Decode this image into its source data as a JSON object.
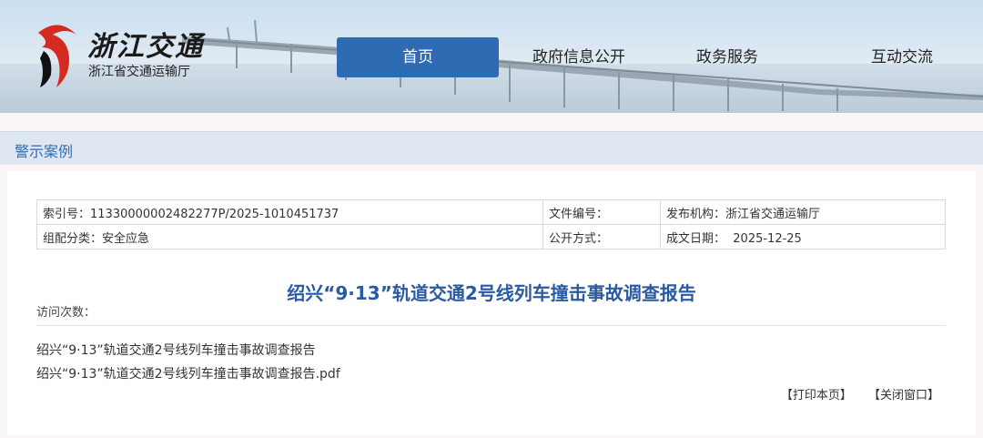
{
  "header": {
    "logo_title": "浙江交通",
    "logo_subtitle": "浙江省交通运输厅"
  },
  "nav": {
    "items": [
      {
        "label": "首页",
        "active": true
      },
      {
        "label": "政府信息公开"
      },
      {
        "label": "政务服务"
      },
      {
        "label": "互动交流"
      }
    ]
  },
  "section": {
    "title": "警示案例"
  },
  "meta": {
    "index_label": "索引号：",
    "index_value": "11330000002482277P/2025-1010451737",
    "doc_no_label": "文件编号：",
    "doc_no_value": "",
    "publisher_label": "发布机构：",
    "publisher_value": "浙江省交通运输厅",
    "category_label": "组配分类：",
    "category_value": "安全应急",
    "disclosure_label": "公开方式：",
    "disclosure_value": "",
    "date_label": "成文日期：",
    "date_value": "2025-12-25"
  },
  "article": {
    "title": "绍兴“9·13”轨道交通2号线列车撞击事故调查报告",
    "visits_label": "访问次数：",
    "line1": "绍兴“9·13”轨道交通2号线列车撞击事故调查报告",
    "line2": "绍兴“9·13”轨道交通2号线列车撞击事故调查报告.pdf"
  },
  "actions": {
    "print": "【打印本页】",
    "close": "【关闭窗口】"
  },
  "colors": {
    "brand_blue": "#2f6bb3",
    "title_blue": "#2a5aa0",
    "logo_red": "#d42a1f"
  }
}
